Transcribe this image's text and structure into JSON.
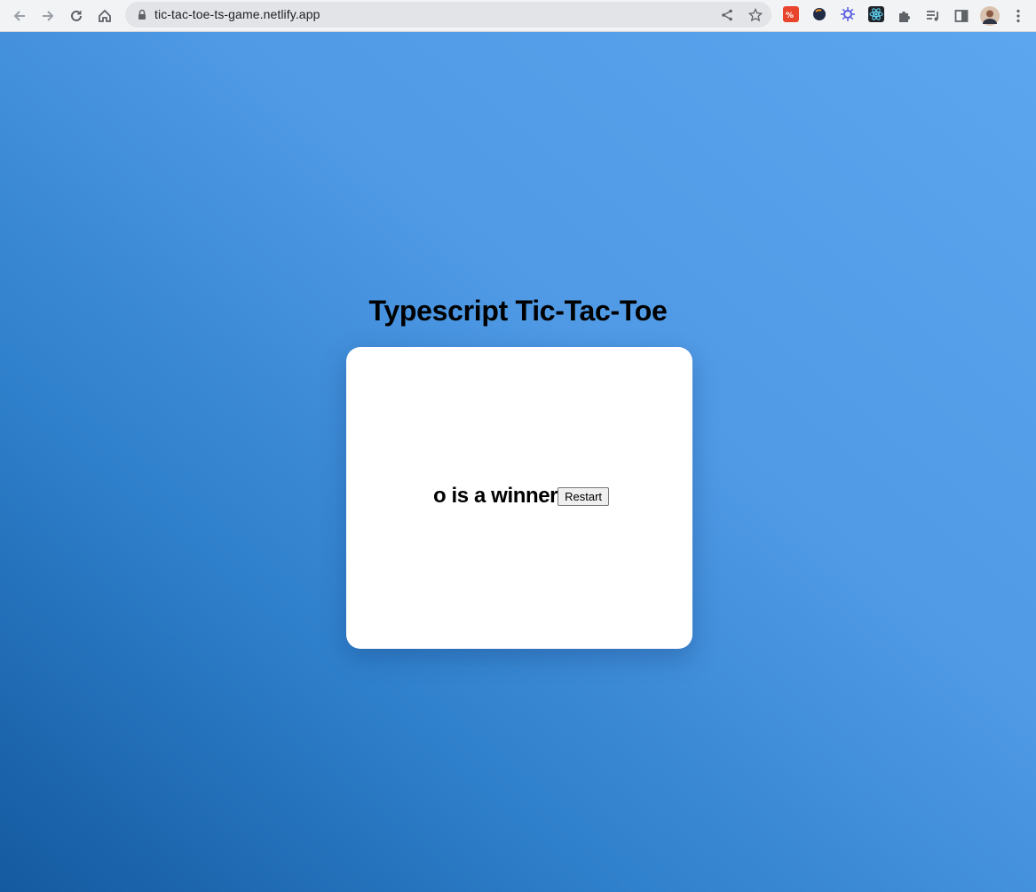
{
  "browser": {
    "url": "tic-tac-toe-ts-game.netlify.app",
    "nav_icons": [
      "back-arrow-icon",
      "forward-arrow-icon",
      "reload-icon",
      "home-icon"
    ],
    "omnibox_icons": [
      "lock-icon",
      "share-icon",
      "star-icon"
    ],
    "extensions": [
      {
        "name": "translate-extension-icon",
        "color": "#e8452c"
      },
      {
        "name": "dark-circle-extension-icon",
        "color": "#1f2a44"
      },
      {
        "name": "gear-extension-icon",
        "color": "#5b5fe0"
      },
      {
        "name": "react-devtools-icon",
        "color": "#20232a"
      }
    ],
    "toolbar_icons": [
      "puzzle-icon",
      "media-control-icon",
      "side-panel-icon",
      "profile-avatar",
      "more-menu-icon"
    ]
  },
  "game": {
    "title": "Typescript Tic-Tac-Toe",
    "status_text": "o is a winner",
    "restart_label": "Restart"
  },
  "colors": {
    "background_gradient": [
      "#145aa0",
      "#5ca6ef"
    ],
    "card": "#ffffff"
  }
}
